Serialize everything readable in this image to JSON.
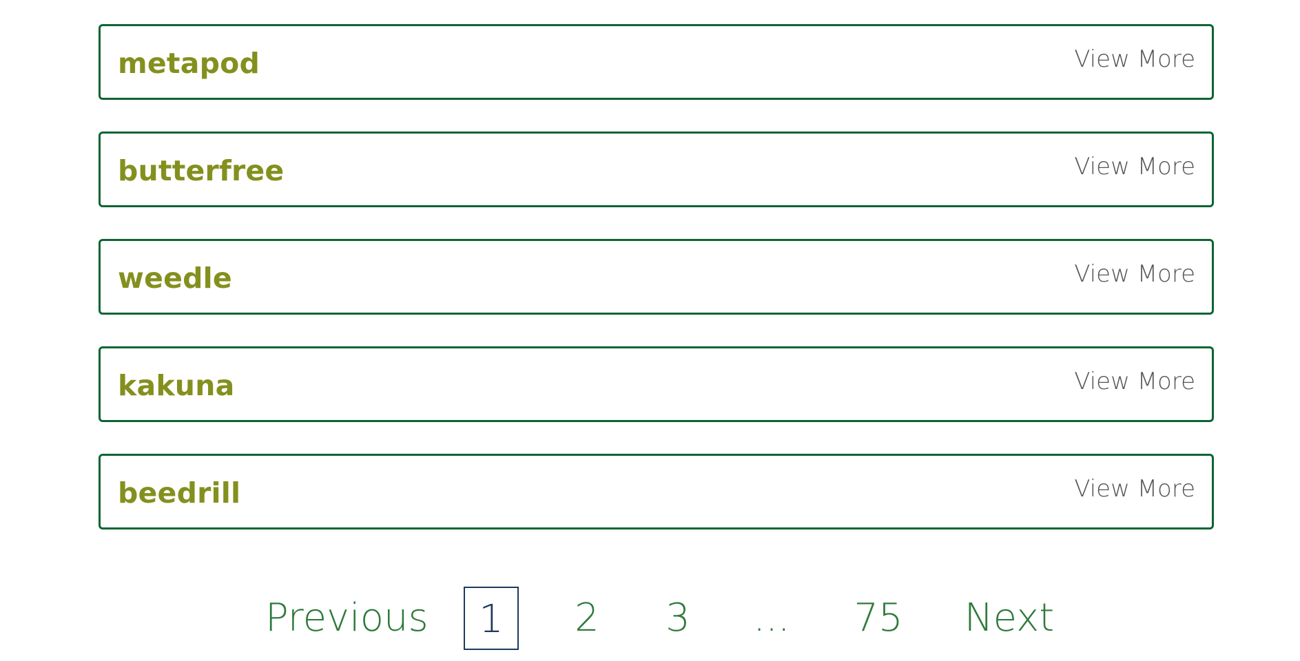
{
  "items": [
    {
      "name": "metapod",
      "action": "View More"
    },
    {
      "name": "butterfree",
      "action": "View More"
    },
    {
      "name": "weedle",
      "action": "View More"
    },
    {
      "name": "kakuna",
      "action": "View More"
    },
    {
      "name": "beedrill",
      "action": "View More"
    }
  ],
  "pagination": {
    "previous": "Previous",
    "pages": [
      "1",
      "2",
      "3"
    ],
    "ellipsis": "...",
    "last": "75",
    "next": "Next",
    "current": "1"
  },
  "colors": {
    "border": "#0c6433",
    "name": "#84901e",
    "view_more": "#555555",
    "pager_text": "#2f7a3b",
    "current_page": "#1d3a5f"
  }
}
